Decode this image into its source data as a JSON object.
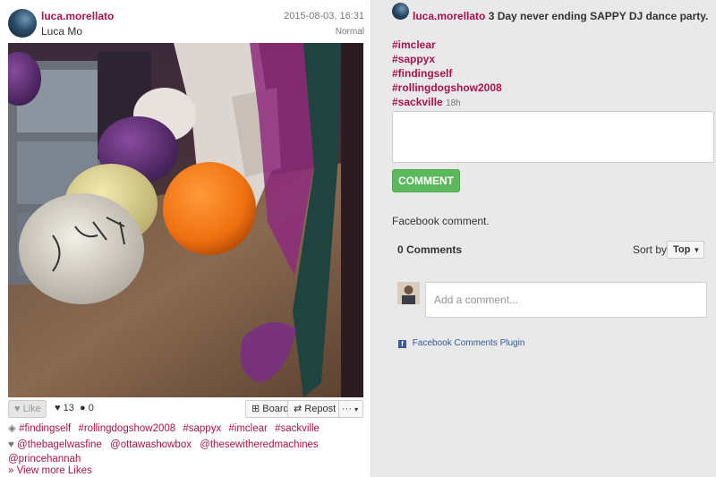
{
  "post": {
    "username": "luca.morellato",
    "full_name": "Luca Mo",
    "timestamp": "2015-08-03, 16:31",
    "filter": "Normal",
    "like_label": "Like",
    "like_count": "13",
    "comment_count": "0",
    "board_label": "Board",
    "repost_label": "Repost",
    "more_label": "···",
    "tags": [
      "#findingself",
      "#rollingdogshow2008",
      "#sappyx",
      "#imclear",
      "#sackville"
    ],
    "likers": [
      "@thebagelwasfine",
      "@ottawashowbox",
      "@thesewitheredmachines",
      "@princehannah"
    ],
    "view_more_likes": "» View more Likes"
  },
  "caption": {
    "username": "luca.morellato",
    "text": "3 Day never ending SAPPY DJ dance party.",
    "hashtags": [
      "#imclear",
      "#sappyx",
      "#findingself",
      "#rollingdogshow2008",
      "#sackville"
    ],
    "age": "18h"
  },
  "comment_form": {
    "button_label": "COMMENT",
    "facebook_label": "Facebook comment."
  },
  "facebook": {
    "count_label": "0 Comments",
    "sort_label": "Sort by",
    "sort_value": "Top",
    "placeholder": "Add a comment...",
    "plugin_label": "Facebook Comments Plugin"
  },
  "colors": {
    "accent": "#a3154d",
    "comment_button": "#5cb85c",
    "facebook_blue": "#3b5998"
  },
  "icons": [
    "heart-icon",
    "speech-bubble-icon",
    "plus-square-icon",
    "repost-icon",
    "tag-icon",
    "facebook-icon",
    "chevron-down-icon"
  ]
}
